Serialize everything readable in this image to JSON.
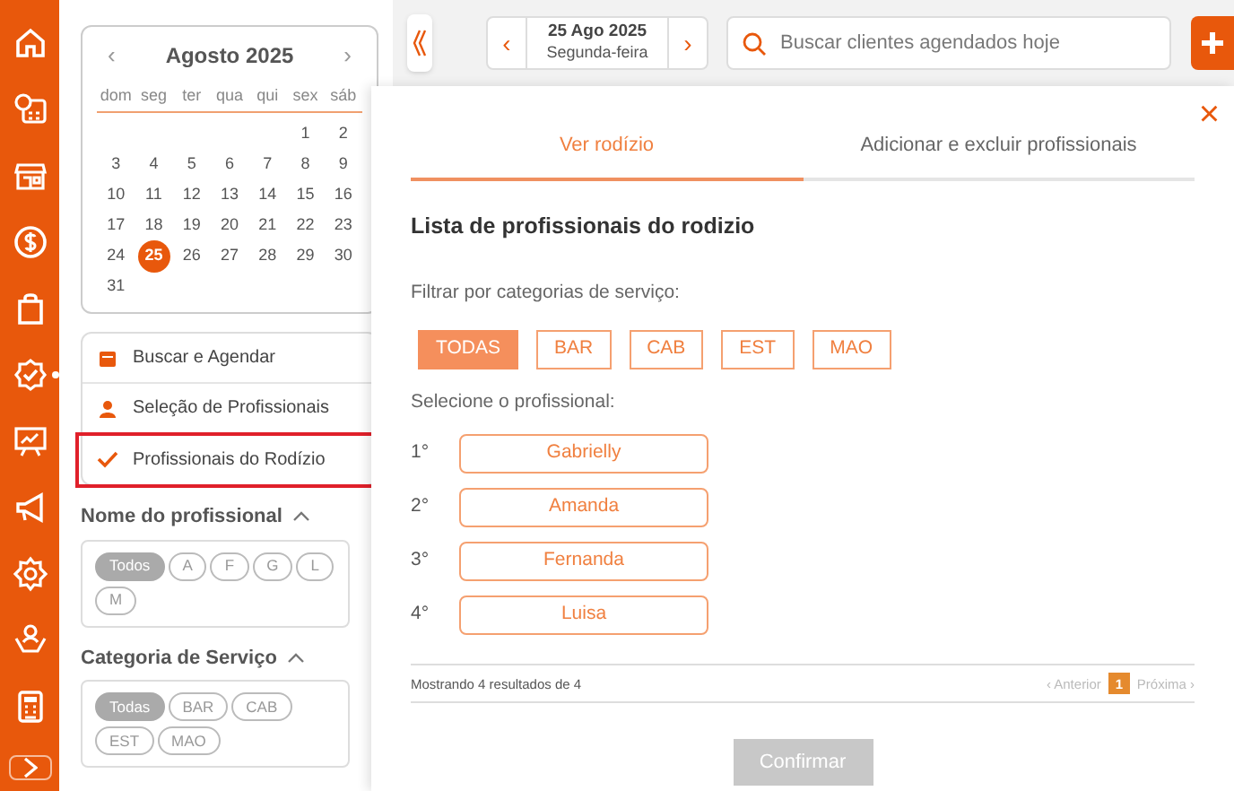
{
  "calendar": {
    "prev": "‹",
    "next": "›",
    "month": "Agosto 2025",
    "weekdays": [
      "dom",
      "seg",
      "ter",
      "qua",
      "qui",
      "sex",
      "sáb"
    ],
    "weeks": [
      [
        {
          "day": "1",
          "selected": false
        },
        {
          "day": "2",
          "selected": false
        }
      ],
      [
        {
          "day": "3",
          "selected": false
        },
        {
          "day": "4",
          "selected": false
        },
        {
          "day": "5",
          "selected": false
        },
        {
          "day": "6",
          "selected": false
        },
        {
          "day": "7",
          "selected": false
        },
        {
          "day": "8",
          "selected": false
        },
        {
          "day": "9",
          "selected": false
        }
      ],
      [
        {
          "day": "10",
          "selected": false
        },
        {
          "day": "11",
          "selected": false
        },
        {
          "day": "12",
          "selected": false
        },
        {
          "day": "13",
          "selected": false
        },
        {
          "day": "14",
          "selected": false
        },
        {
          "day": "15",
          "selected": false
        },
        {
          "day": "16",
          "selected": false
        }
      ],
      [
        {
          "day": "17",
          "selected": false
        },
        {
          "day": "18",
          "selected": false
        },
        {
          "day": "19",
          "selected": false
        },
        {
          "day": "20",
          "selected": false
        },
        {
          "day": "21",
          "selected": false
        },
        {
          "day": "22",
          "selected": false
        },
        {
          "day": "23",
          "selected": false
        }
      ],
      [
        {
          "day": "24",
          "selected": false
        },
        {
          "day": "25",
          "selected": true
        },
        {
          "day": "26",
          "selected": false
        },
        {
          "day": "27",
          "selected": false
        },
        {
          "day": "28",
          "selected": false
        },
        {
          "day": "29",
          "selected": false
        },
        {
          "day": "30",
          "selected": false
        }
      ],
      [
        {
          "day": "31",
          "selected": false
        }
      ]
    ]
  },
  "menu": [
    {
      "kind": "calendar",
      "label": "Buscar e Agendar",
      "highlighted": false
    },
    {
      "kind": "person",
      "label": "Seleção de Profissionais",
      "highlighted": false
    },
    {
      "kind": "check",
      "label": "Profissionais do Rodízio",
      "highlighted": true
    }
  ],
  "filters": [
    {
      "title": "Nome do profissional",
      "chips": [
        {
          "label": "Todos",
          "selected": true
        },
        {
          "label": "A",
          "selected": false
        },
        {
          "label": "F",
          "selected": false
        },
        {
          "label": "G",
          "selected": false
        },
        {
          "label": "L",
          "selected": false
        },
        {
          "label": "M",
          "selected": false
        }
      ]
    },
    {
      "title": "Categoria de Serviço",
      "chips": [
        {
          "label": "Todas",
          "selected": true
        },
        {
          "label": "BAR",
          "selected": false
        },
        {
          "label": "CAB",
          "selected": false
        },
        {
          "label": "EST",
          "selected": false
        },
        {
          "label": "MAO",
          "selected": false
        }
      ]
    }
  ],
  "topbar": {
    "prev": "‹",
    "date": "25 Ago 2025",
    "weekday": "Segunda-feira",
    "next": "›",
    "search": {
      "placeholder": "Buscar clientes agendados hoje"
    }
  },
  "modal": {
    "close": "×",
    "tabs": [
      {
        "label": "Ver rodízio",
        "selected": true
      },
      {
        "label": "Adicionar e excluir profissionais",
        "selected": false
      }
    ],
    "title": "Lista de profissionais do rodizio",
    "filter_label": "Filtrar por categorias de serviço:",
    "categories": [
      {
        "label": "TODAS",
        "selected": true
      },
      {
        "label": "BAR",
        "selected": false
      },
      {
        "label": "CAB",
        "selected": false
      },
      {
        "label": "EST",
        "selected": false
      },
      {
        "label": "MAO",
        "selected": false
      }
    ],
    "select_label": "Selecione o profissional:",
    "professionals": [
      {
        "rank": "1°",
        "name": "Gabrielly"
      },
      {
        "rank": "2°",
        "name": "Amanda"
      },
      {
        "rank": "3°",
        "name": "Fernanda"
      },
      {
        "rank": "4°",
        "name": "Luisa"
      }
    ],
    "summary": "Mostrando 4 resultados de 4",
    "pagination": {
      "prev": "‹ Anterior",
      "page": "1",
      "next": "Próxima ›",
      "prev_disabled": true,
      "next_disabled": true
    },
    "confirm": {
      "label": "Confirmar",
      "disabled": true
    }
  }
}
